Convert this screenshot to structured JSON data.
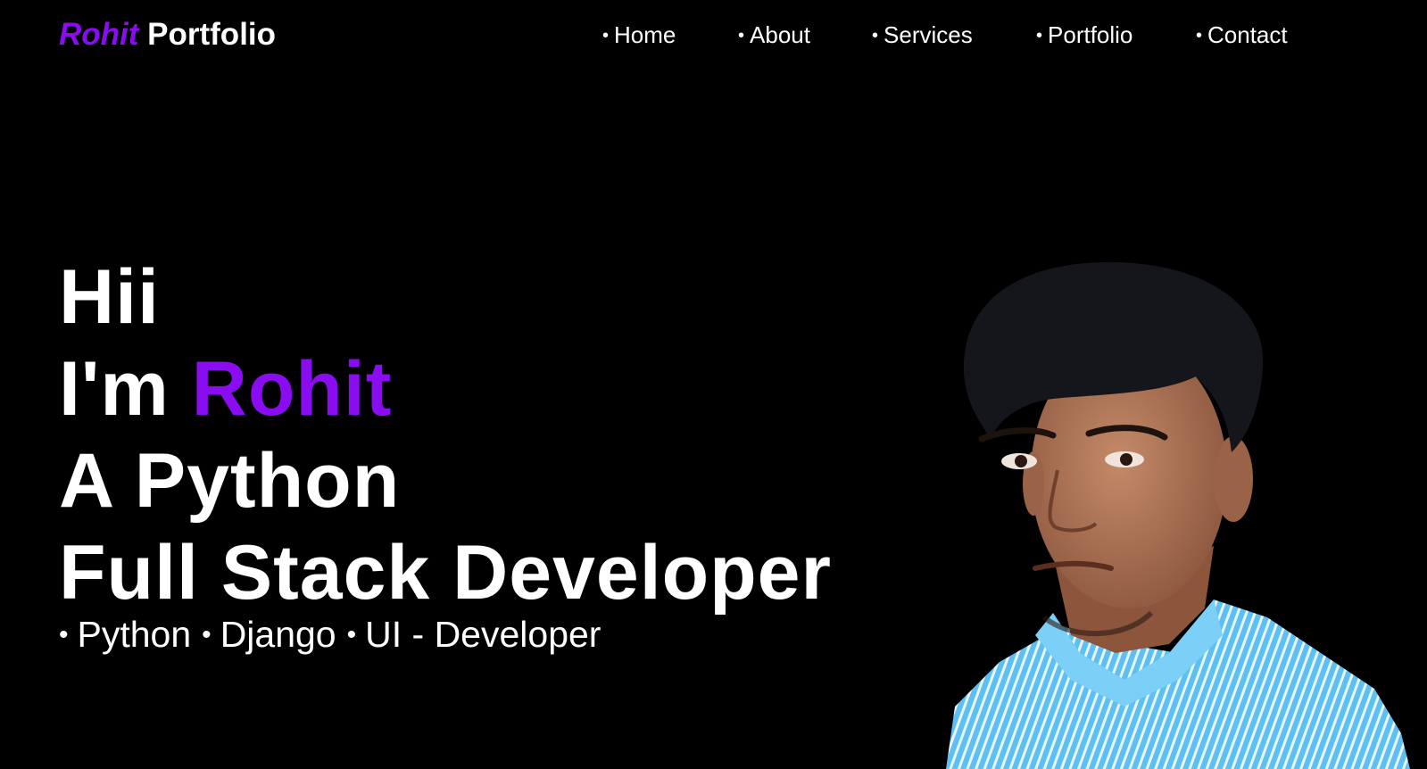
{
  "header": {
    "brand_first": "Rohit",
    "brand_last": "Portfolio",
    "nav": [
      {
        "label": "Home"
      },
      {
        "label": "About"
      },
      {
        "label": "Services"
      },
      {
        "label": "Portfolio"
      },
      {
        "label": "Contact"
      }
    ],
    "bullet": "•"
  },
  "hero": {
    "line1": "Hii",
    "line2_prefix": "I'm",
    "line2_name": "Rohit",
    "line3": "A Python",
    "line4": "Full Stack Developer",
    "skills": [
      "Python",
      "Django",
      "UI - Developer"
    ]
  },
  "colors": {
    "background": "#000000",
    "accent": "#8a0cf0",
    "text": "#ffffff",
    "shirt": "#4fb6ee",
    "skin": "#b3785a",
    "hair": "#15151c"
  }
}
